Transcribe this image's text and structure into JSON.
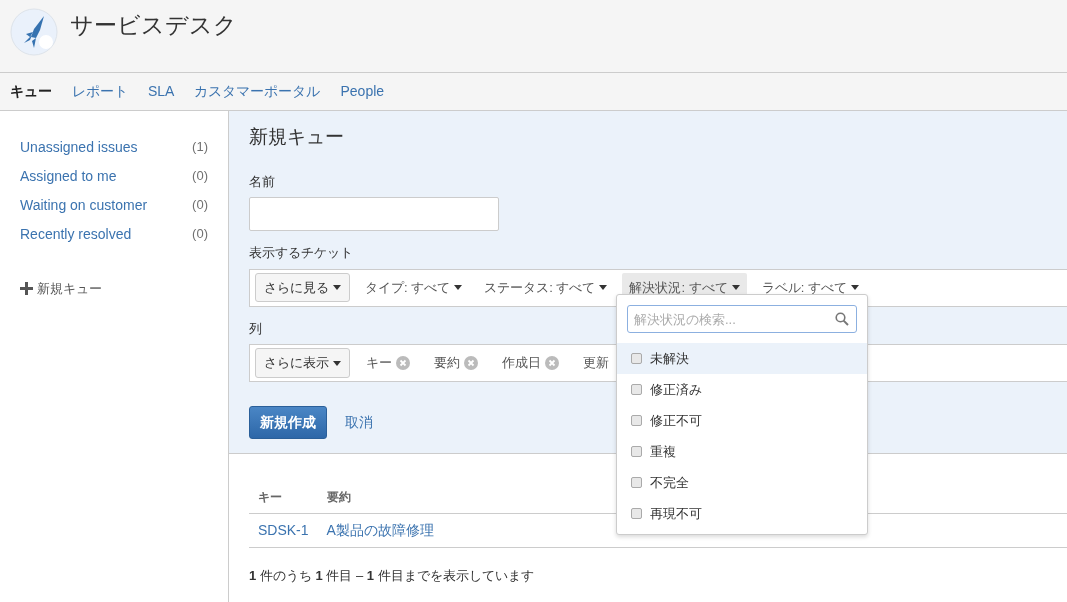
{
  "header": {
    "title": "サービスデスク"
  },
  "tabs": [
    {
      "label": "キュー",
      "selected": true
    },
    {
      "label": "レポート",
      "selected": false
    },
    {
      "label": "SLA",
      "selected": false
    },
    {
      "label": "カスタマーポータル",
      "selected": false
    },
    {
      "label": "People",
      "selected": false
    }
  ],
  "sidebar": {
    "queues": [
      {
        "label": "Unassigned issues",
        "count": "(1)"
      },
      {
        "label": "Assigned to me",
        "count": "(0)"
      },
      {
        "label": "Waiting on customer",
        "count": "(0)"
      },
      {
        "label": "Recently resolved",
        "count": "(0)"
      }
    ],
    "new_queue": "新規キュー"
  },
  "form": {
    "title": "新規キュー",
    "name_label": "名前",
    "tickets_label": "表示するチケット",
    "more_button": "さらに見る",
    "filters": [
      {
        "label": "タイプ:",
        "value": "すべて",
        "selected": false
      },
      {
        "label": "ステータス:",
        "value": "すべて",
        "selected": false
      },
      {
        "label": "解決状況:",
        "value": "すべて",
        "selected": true
      },
      {
        "label": "ラベル:",
        "value": "すべて",
        "selected": false
      }
    ],
    "columns_label": "列",
    "show_more_button": "さらに表示",
    "columns": [
      {
        "label": "キー",
        "removable": true
      },
      {
        "label": "要約",
        "removable": true
      },
      {
        "label": "作成日",
        "removable": true
      },
      {
        "label": "更新",
        "removable": false
      }
    ],
    "create_button": "新規作成",
    "cancel_link": "取消"
  },
  "dropdown": {
    "placeholder": "解決状況の検索...",
    "options": [
      {
        "label": "未解決",
        "checked": false,
        "selected": true
      },
      {
        "label": "修正済み",
        "checked": false,
        "selected": false
      },
      {
        "label": "修正不可",
        "checked": false,
        "selected": false
      },
      {
        "label": "重複",
        "checked": false,
        "selected": false
      },
      {
        "label": "不完全",
        "checked": false,
        "selected": false
      },
      {
        "label": "再現不可",
        "checked": false,
        "selected": false
      }
    ]
  },
  "table": {
    "columns": [
      "キー",
      "要約"
    ],
    "rows": [
      [
        "SDSK-1",
        "A製品の故障修理"
      ]
    ]
  },
  "footer": "**1** 件のうち **1** 件目 – **1** 件目までを表示しています"
}
